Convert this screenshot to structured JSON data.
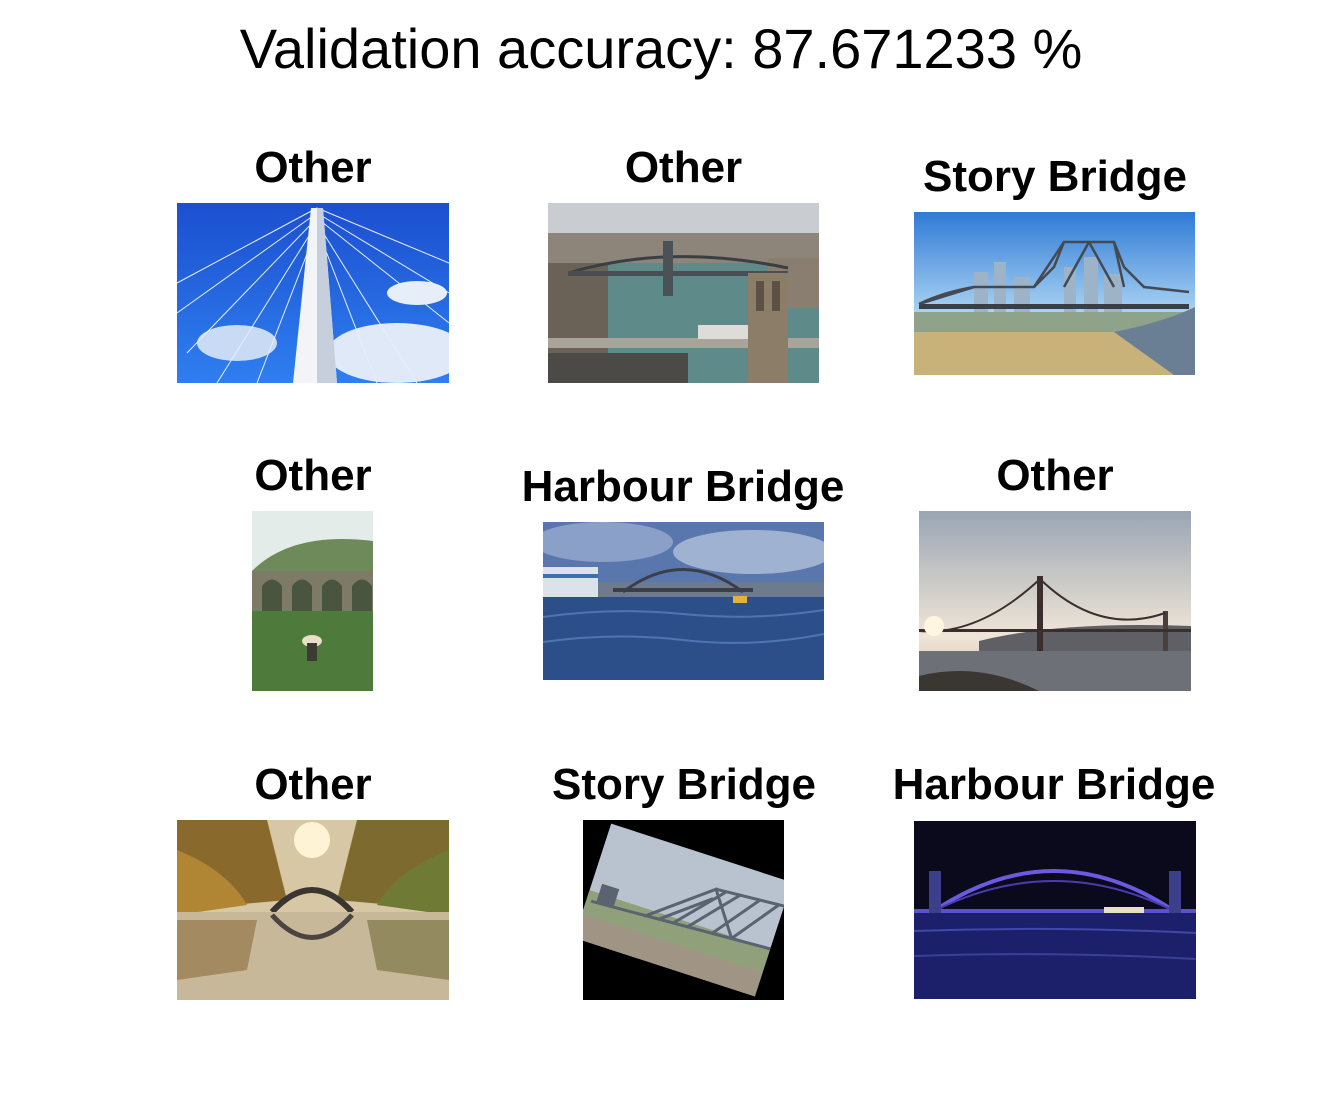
{
  "figure": {
    "title": "Validation accuracy: 87.671233 %"
  },
  "grid": {
    "items": [
      {
        "label": "Other",
        "image": "cable-stayed-bridge-pylon-blue-sky"
      },
      {
        "label": "Other",
        "image": "manhattan-brooklyn-bridges-river-noisy"
      },
      {
        "label": "Story Bridge",
        "image": "story-bridge-brisbane-river"
      },
      {
        "label": "Other",
        "image": "stone-viaduct-green-hillside-noisy"
      },
      {
        "label": "Harbour Bridge",
        "image": "sydney-harbour-bridge-day-noisy"
      },
      {
        "label": "Other",
        "image": "golden-gate-bridge-sunset"
      },
      {
        "label": "Other",
        "image": "arched-devils-bridge-autumn-reflection"
      },
      {
        "label": "Story Bridge",
        "image": "story-bridge-rotated-black-border"
      },
      {
        "label": "Harbour Bridge",
        "image": "sydney-harbour-bridge-night-noisy"
      }
    ]
  }
}
